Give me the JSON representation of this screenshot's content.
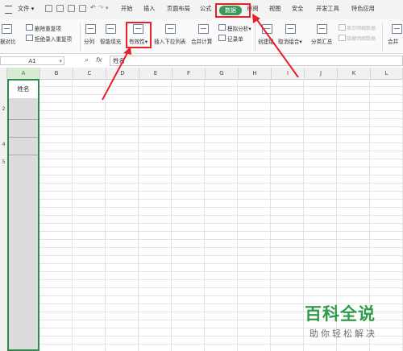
{
  "menu": {
    "file": "文件",
    "tabs": [
      "开始",
      "插入",
      "页面布局",
      "公式",
      "数据",
      "审阅",
      "视图",
      "安全",
      "开发工具",
      "特色应用"
    ]
  },
  "ribbon": {
    "compare": "据对比",
    "remove_dup": "删除重复项",
    "reject_dup": "拒绝录入重复项",
    "split": "分列",
    "smart_fill": "智能填充",
    "validity": "有效性",
    "dropdown": "插入下拉列表",
    "merge_calc": "合并计算",
    "simulate": "模拟分析",
    "record": "记录单",
    "create_group": "创建组",
    "ungroup": "取消组合",
    "subtotal": "分类汇总",
    "show_detail": "显示明细数据",
    "hide_detail": "隐藏明细数据",
    "merge_tab": "合并"
  },
  "formula_bar": {
    "name_box": "A1",
    "fx": "fx",
    "content": "姓名"
  },
  "columns": [
    "A",
    "B",
    "C",
    "D",
    "E",
    "F",
    "G",
    "H",
    "I",
    "J",
    "K",
    "L"
  ],
  "cells": {
    "a1": "姓名"
  },
  "watermark": {
    "title": "百科全说",
    "subtitle": "助你轻松解决"
  },
  "colors": {
    "accent": "#3a9a5b",
    "annotation": "#e8202a",
    "selection": "#2e8b4e"
  }
}
